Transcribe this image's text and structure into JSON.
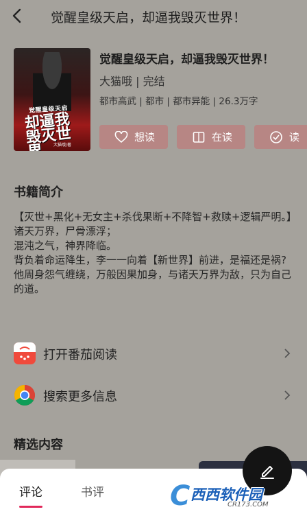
{
  "header": {
    "title": "觉醒皇级天启，却逼我毁灭世界！"
  },
  "cover": {
    "subtitle": "觉醒皇级天启",
    "big_title": "却逼我毁灭世界",
    "author_mark": "大猫哦/著"
  },
  "book": {
    "title": "觉醒皇级天启，却逼我毁灭世界！",
    "author_status": "大猫哦 | 完结",
    "meta": "都市高武 | 都市 | 都市异能 | 26.3万字"
  },
  "actions": {
    "want": "想读",
    "reading": "在读",
    "done": "读"
  },
  "intro": {
    "heading": "书籍简介",
    "paragraphs": [
      "【灭世+黑化+无女主+杀伐果断+不降智+救赎+逻辑严明。】",
      "诸天万界，尸骨漂浮；",
      "混沌之气，神界降临。",
      "背负着命运降生，李一一向着【新世界】前进，是福还是祸?",
      "他周身怨气缠绕，万般因果加身，与诸天万界为敌，只为自己的道。"
    ]
  },
  "links": [
    {
      "label": "打开番茄阅读",
      "icon": "tomato-reader-icon"
    },
    {
      "label": "搜索更多信息",
      "icon": "chrome-icon"
    }
  ],
  "featured": {
    "heading": "精选内容"
  },
  "tabs": {
    "comments": "评论",
    "reviews": "书评"
  },
  "watermark": {
    "main": "西西软件园",
    "url": "CR173.COM"
  },
  "colors": {
    "background": "#a5a29c",
    "accent": "#e1285a",
    "action_button": "#b78684"
  }
}
